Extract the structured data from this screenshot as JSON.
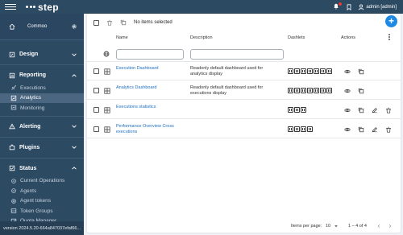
{
  "brand": {
    "name": "step"
  },
  "user": {
    "label": "admin [admin]"
  },
  "sidebar": {
    "project": "Commoo",
    "design": "Design",
    "reporting": "Reporting",
    "reporting_items": [
      "Executions",
      "Analytics",
      "Monitoring"
    ],
    "alerting": "Alerting",
    "plugins": "Plugins",
    "status": "Status",
    "status_items": [
      "Current Operations",
      "Agents",
      "Agent tokens",
      "Token Groups",
      "Quota Manager"
    ],
    "version": "version 2024.5.20-664a847037efaf66..."
  },
  "toolbar": {
    "selection_text": "No items selected",
    "add_label": "+"
  },
  "table": {
    "headers": {
      "name": "Name",
      "description": "Description",
      "dashlets": "Dashlets",
      "actions": "Actions"
    },
    "filter": {
      "name_value": "",
      "description_value": ""
    },
    "rows": [
      {
        "name": "Execution Dashboard",
        "description": "Readonly default dashboard used for analytics display",
        "dashlet_count": 7,
        "editable": false
      },
      {
        "name": "Analytics Dashboard",
        "description": "Readonly default dashboard used for executions display",
        "dashlet_count": 7,
        "editable": false
      },
      {
        "name": "Executions statistics",
        "description": "",
        "dashlet_count": 3,
        "editable": true
      },
      {
        "name": "Performance Overview Cross executions",
        "description": "",
        "dashlet_count": 4,
        "editable": true
      }
    ]
  },
  "pagination": {
    "items_per_page_label": "Items per page:",
    "items_per_page": "10",
    "range": "1 – 4 of 4"
  },
  "colors": {
    "nav_bg": "#2d4a63",
    "accent": "#1e88e5",
    "link": "#1e6fbf",
    "notify": "#e53935"
  },
  "icons": [
    "menu-icon",
    "bell-icon",
    "bookmark-icon",
    "user-icon",
    "home-icon",
    "gear-icon",
    "design-icon",
    "reporting-icon",
    "rocket-icon",
    "analytics-icon",
    "monitoring-icon",
    "alert-icon",
    "plugin-icon",
    "status-icon",
    "globe-icon",
    "grid-icon",
    "eye-icon",
    "copy-icon",
    "edit-icon",
    "trash-icon"
  ]
}
